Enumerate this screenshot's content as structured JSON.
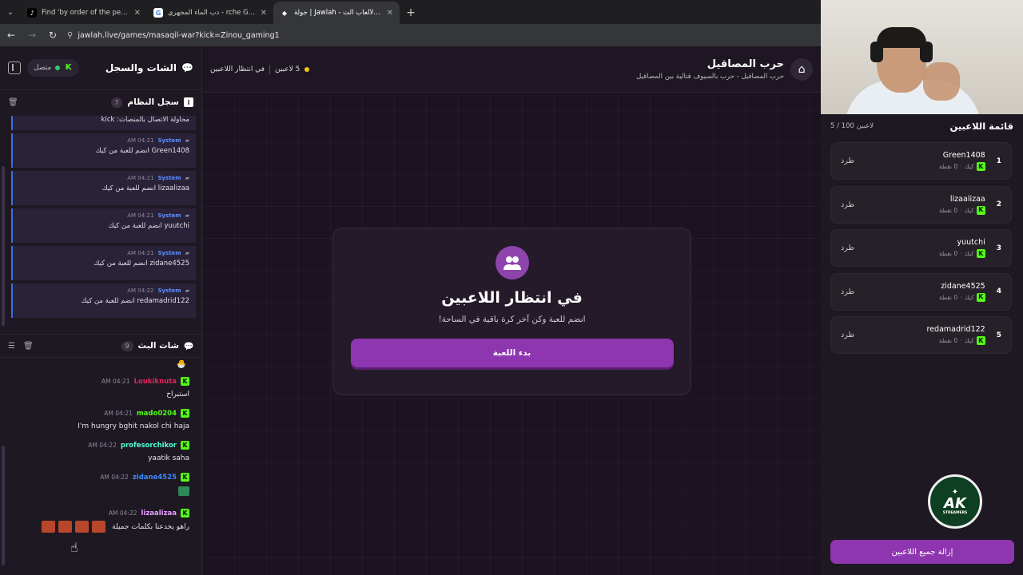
{
  "browser": {
    "tabs": [
      {
        "title": "Find 'by order of the peaky blind",
        "icon": "tiktok-icon"
      },
      {
        "title": "دب الماء المجهري - rche Google",
        "icon": "google-icon"
      },
      {
        "title": "جولة | Jawlah - منصة الألعاب الت",
        "icon": "jawlah-icon"
      }
    ],
    "url": "jawlah.live/games/masaqil-war?kick=Zinou_gaming1"
  },
  "chat_panel": {
    "title": "الشات والسجل",
    "status": "متصل",
    "system_log": {
      "title": "سجل النظام",
      "count": "7",
      "partial_msg": "محاولة الاتصال بالمنصات: kick",
      "items": [
        {
          "sender": "System",
          "time": "04:21 AM",
          "msg": "Green1408 انضم للعبة من كيك"
        },
        {
          "sender": "System",
          "time": "04:21 AM",
          "msg": "lizaalizaa انضم للعبة من كيك"
        },
        {
          "sender": "System",
          "time": "04:21 AM",
          "msg": "yuutchi انضم للعبة من كيك"
        },
        {
          "sender": "System",
          "time": "04:21 AM",
          "msg": "zidane4525 انضم للعبة من كيك"
        },
        {
          "sender": "System",
          "time": "04:22 AM",
          "msg": "redamadrid122 انضم للعبة من كيك"
        }
      ]
    },
    "stream_chat": {
      "title": "شات البث",
      "count": "9",
      "messages": [
        {
          "user": "Loukiknuta",
          "time": "04:21 AM",
          "text": "استبراح",
          "color": "#e0245e"
        },
        {
          "user": "mado0204",
          "time": "04:21 AM",
          "text": "I'm hungry bghit nakol chi haja",
          "color": "#53fc18"
        },
        {
          "user": "profesorchikor",
          "time": "04:22 AM",
          "text": "yaatik saha",
          "color": "#53fcd2"
        },
        {
          "user": "zidane4525",
          "time": "04:22 AM",
          "text": "",
          "color": "#3a8bff"
        },
        {
          "user": "lizaalizaa",
          "time": "04:22 AM",
          "text": "راهو يخدعنا بكلمات جميلة",
          "color": "#e79cff"
        }
      ]
    }
  },
  "game": {
    "title": "حرب المصاقيل",
    "subtitle": "حرب المصاقيل - حرب بالسيوف قتالية بين المصاقيل",
    "players_count": "5 لاعبين",
    "state": "في انتظار اللاعبين",
    "card": {
      "title": "في انتظار اللاعبين",
      "subtitle": "انضم للعبة وكن آخر كرة باقية في الساحة!",
      "start_button": "بدء اللعبة"
    }
  },
  "players_panel": {
    "title": "قائمة اللاعبين",
    "count": "5 / 100 لاعبين",
    "players": [
      {
        "rank": "1",
        "name": "Green1408",
        "platform": "كيك",
        "points": "0 نقطة",
        "kick_label": "طرد"
      },
      {
        "rank": "2",
        "name": "lizaalizaa",
        "platform": "كيك",
        "points": "0 نقطة",
        "kick_label": "طرد"
      },
      {
        "rank": "3",
        "name": "yuutchi",
        "platform": "كيك",
        "points": "0 نقطة",
        "kick_label": "طرد"
      },
      {
        "rank": "4",
        "name": "zidane4525",
        "platform": "كيك",
        "points": "0 نقطة",
        "kick_label": "طرد"
      },
      {
        "rank": "5",
        "name": "redamadrid122",
        "platform": "كيك",
        "points": "0 نقطة",
        "kick_label": "طرد"
      }
    ],
    "clear_button": "إزالة جميع اللاعبين",
    "logo": {
      "main": "AK",
      "sub": "STREAMERS"
    }
  }
}
